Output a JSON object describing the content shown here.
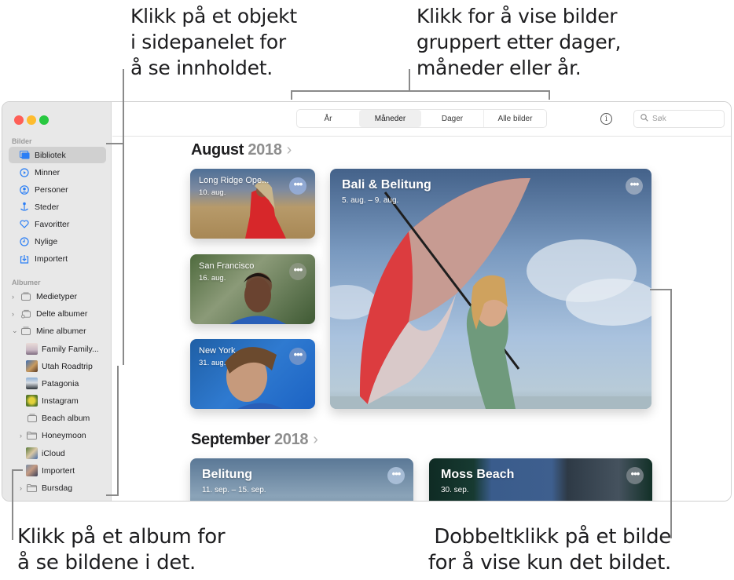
{
  "callouts": {
    "sidebar": [
      "Klikk på et objekt",
      "i sidepanelet for",
      "å se innholdet."
    ],
    "views": [
      "Klikk for å vise bilder",
      "gruppert etter dager,",
      "måneder eller år."
    ],
    "album": [
      "Klikk på et album for",
      "å se bildene i det."
    ],
    "photo": [
      "Dobbeltklikk på et bilde",
      "for å vise kun det bildet."
    ]
  },
  "sidebar": {
    "section_photos": "Bilder",
    "photos_items": [
      {
        "label": "Bibliotek",
        "icon": "library-icon",
        "selected": true
      },
      {
        "label": "Minner",
        "icon": "memories-icon"
      },
      {
        "label": "Personer",
        "icon": "people-icon"
      },
      {
        "label": "Steder",
        "icon": "places-icon"
      },
      {
        "label": "Favoritter",
        "icon": "heart-icon"
      },
      {
        "label": "Nylige",
        "icon": "clock-icon"
      },
      {
        "label": "Importert",
        "icon": "import-icon"
      }
    ],
    "section_albums": "Albumer",
    "album_items": [
      {
        "label": "Medietyper",
        "icon": "album-stack-icon",
        "disclosure": "collapsed"
      },
      {
        "label": "Delte albumer",
        "icon": "shared-album-icon",
        "disclosure": "collapsed"
      },
      {
        "label": "Mine albumer",
        "icon": "album-stack-icon",
        "disclosure": "expanded"
      },
      {
        "label": "Family Family...",
        "icon": "album-thumbnail"
      },
      {
        "label": "Utah Roadtrip",
        "icon": "album-thumbnail"
      },
      {
        "label": "Patagonia",
        "icon": "album-thumbnail"
      },
      {
        "label": "Instagram",
        "icon": "album-thumbnail"
      },
      {
        "label": "Beach album",
        "icon": "album-stack-icon"
      },
      {
        "label": "Honeymoon",
        "icon": "folder-icon",
        "disclosure": "collapsed"
      },
      {
        "label": "iCloud",
        "icon": "album-thumbnail"
      },
      {
        "label": "Importert",
        "icon": "album-thumbnail"
      },
      {
        "label": "Bursdag",
        "icon": "folder-icon",
        "disclosure": "collapsed"
      }
    ]
  },
  "toolbar": {
    "view_tabs": [
      {
        "label": "År"
      },
      {
        "label": "Måneder",
        "active": true
      },
      {
        "label": "Dager"
      },
      {
        "label": "Alle bilder"
      }
    ],
    "info_icon": "i",
    "search_placeholder": "Søk"
  },
  "months": [
    {
      "month": "August",
      "year": "2018",
      "chevron": "›",
      "cards": [
        {
          "title": "Long Ridge Ope...",
          "date": "10. aug."
        },
        {
          "title": "San Francisco",
          "date": "16. aug."
        },
        {
          "title": "New York",
          "date": "31. aug."
        },
        {
          "title": "Bali & Belitung",
          "date": "5. aug. – 9. aug."
        }
      ]
    },
    {
      "month": "September",
      "year": "2018",
      "chevron": "›",
      "cards": [
        {
          "title": "Belitung",
          "date": "11. sep. – 15. sep."
        },
        {
          "title": "Moss Beach",
          "date": "30. sep."
        }
      ]
    }
  ],
  "more_button": "•••"
}
